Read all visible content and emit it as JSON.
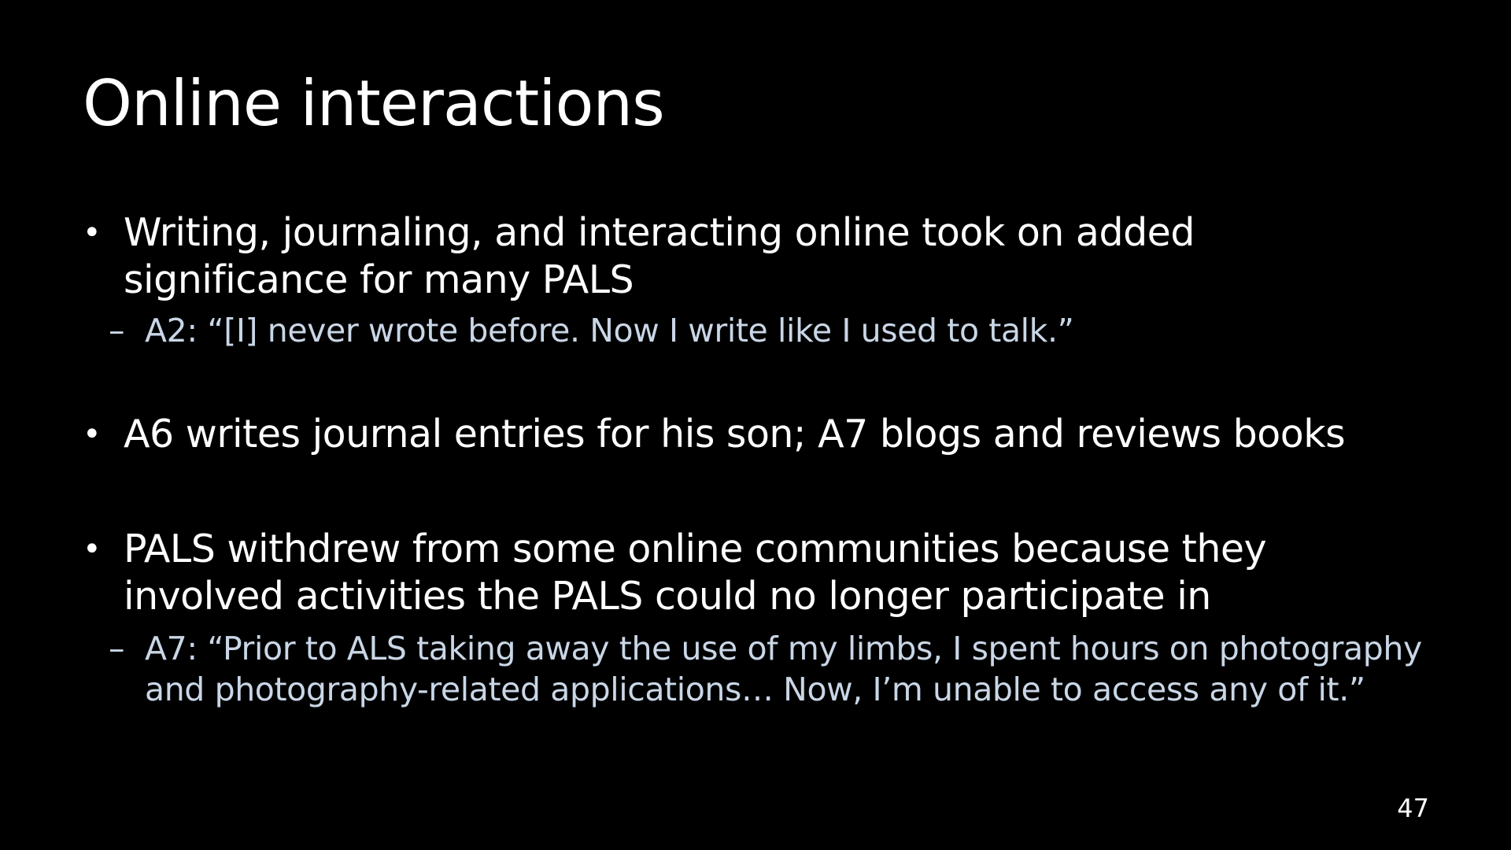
{
  "slide": {
    "title": "Online interactions",
    "bullets": [
      {
        "marker": "•",
        "text": "Writing, journaling, and interacting online took on added significance for many PALS",
        "sub": {
          "marker": "–",
          "text": "A2: “[I] never wrote before. Now I write like I used to talk.”"
        }
      },
      {
        "marker": "•",
        "text": "A6 writes journal entries for his son; A7 blogs and reviews books"
      },
      {
        "marker": "•",
        "text": "PALS withdrew from some online communities because they involved activities the PALS could no longer participate in",
        "sub": {
          "marker": "–",
          "text": "A7: “Prior to ALS taking away the use of my limbs, I spent hours on photography and photography-related applications… Now, I’m unable to access any of it.”"
        }
      }
    ],
    "page_number": "47"
  }
}
